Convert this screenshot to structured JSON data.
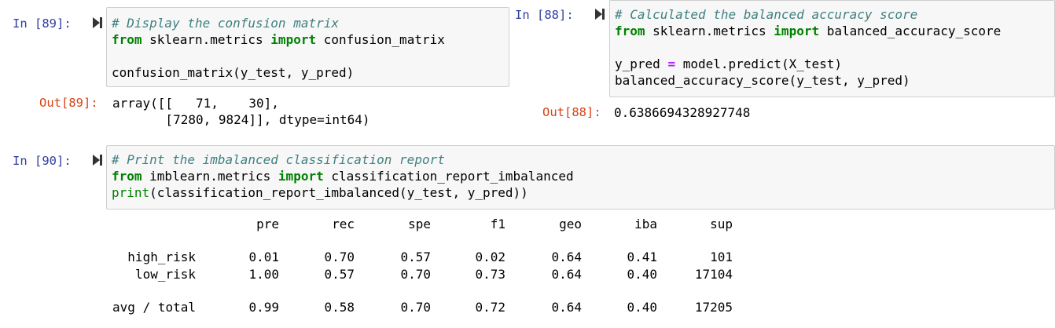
{
  "cells": {
    "c89": {
      "in_prompt": "In [89]:",
      "code": [
        [
          {
            "t": "cm",
            "v": "# Display the confusion matrix"
          }
        ],
        [
          {
            "t": "kw",
            "v": "from"
          },
          {
            "t": "",
            "v": " sklearn.metrics "
          },
          {
            "t": "kw",
            "v": "import"
          },
          {
            "t": "",
            "v": " confusion_matrix"
          }
        ],
        [
          {
            "t": "",
            "v": ""
          }
        ],
        [
          {
            "t": "",
            "v": "confusion_matrix(y_test, y_pred)"
          }
        ]
      ],
      "out_prompt": "Out[89]:",
      "output": [
        "array([[   71,    30],",
        "       [7280, 9824]], dtype=int64)"
      ]
    },
    "c88": {
      "in_prompt": "In [88]:",
      "code": [
        [
          {
            "t": "cm",
            "v": "# Calculated the balanced accuracy score"
          }
        ],
        [
          {
            "t": "kw",
            "v": "from"
          },
          {
            "t": "",
            "v": " sklearn.metrics "
          },
          {
            "t": "kw",
            "v": "import"
          },
          {
            "t": "",
            "v": " balanced_accuracy_score"
          }
        ],
        [
          {
            "t": "",
            "v": ""
          }
        ],
        [
          {
            "t": "",
            "v": "y_pred "
          },
          {
            "t": "op",
            "v": "="
          },
          {
            "t": "",
            "v": " model.predict(X_test)"
          }
        ],
        [
          {
            "t": "",
            "v": "balanced_accuracy_score(y_test, y_pred)"
          }
        ]
      ],
      "out_prompt": "Out[88]:",
      "output": [
        "0.6386694328927748"
      ]
    },
    "c90": {
      "in_prompt": "In [90]:",
      "code": [
        [
          {
            "t": "cm",
            "v": "# Print the imbalanced classification report"
          }
        ],
        [
          {
            "t": "kw",
            "v": "from"
          },
          {
            "t": "",
            "v": " imblearn.metrics "
          },
          {
            "t": "kw",
            "v": "import"
          },
          {
            "t": "",
            "v": " classification_report_imbalanced"
          }
        ],
        [
          {
            "t": "bi",
            "v": "print"
          },
          {
            "t": "",
            "v": "(classification_report_imbalanced(y_test, y_pred))"
          }
        ]
      ],
      "report": {
        "columns": [
          "pre",
          "rec",
          "spe",
          "f1",
          "geo",
          "iba",
          "sup"
        ],
        "rows": [
          {
            "label": "high_risk",
            "values": [
              "0.01",
              "0.70",
              "0.57",
              "0.02",
              "0.64",
              "0.41",
              "101"
            ]
          },
          {
            "label": "low_risk",
            "values": [
              "1.00",
              "0.57",
              "0.70",
              "0.73",
              "0.64",
              "0.40",
              "17104"
            ]
          },
          {
            "label": "avg / total",
            "values": [
              "0.99",
              "0.58",
              "0.70",
              "0.72",
              "0.64",
              "0.40",
              "17205"
            ]
          }
        ]
      }
    }
  },
  "icons": {
    "run": "run-cell-icon"
  },
  "colors": {
    "in_prompt": "#303f9f",
    "out_prompt": "#d84315",
    "comment": "#408080",
    "keyword": "#008000",
    "operator": "#aa22ff",
    "code_bg": "#f7f7f7",
    "code_border": "#cfcfcf"
  }
}
